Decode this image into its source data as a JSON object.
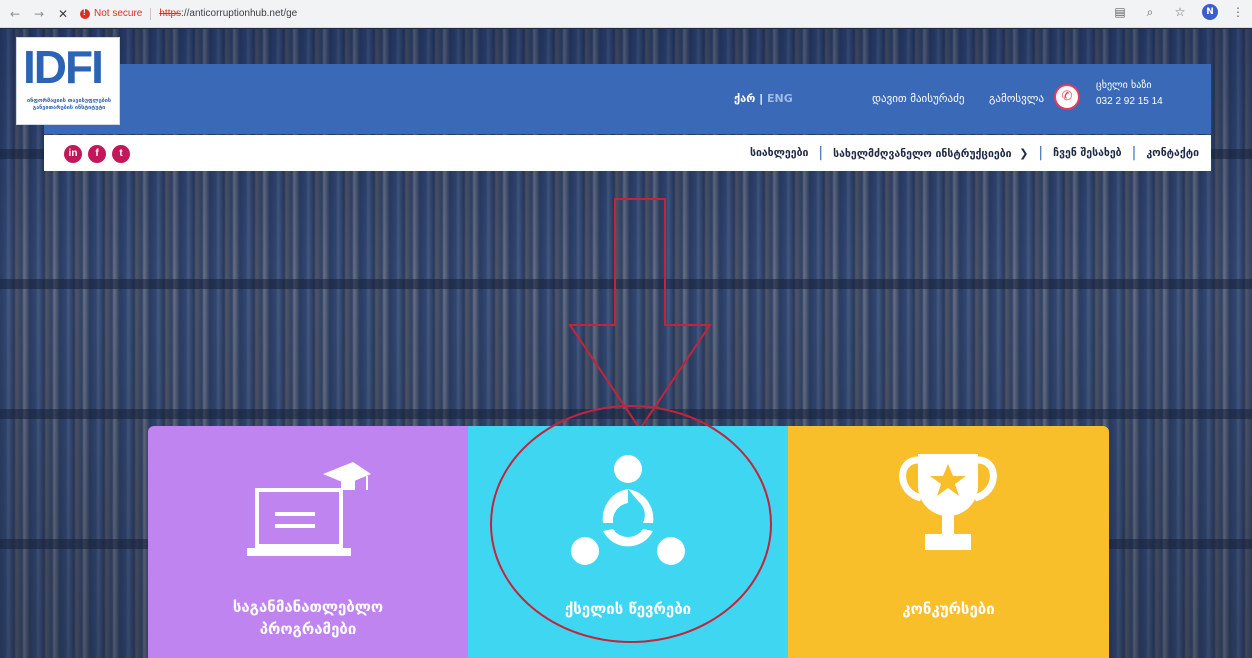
{
  "browser": {
    "nav": {
      "back": "←",
      "forward": "→",
      "stop": "✕"
    },
    "security_text": "Not secure",
    "url_scheme": "https",
    "url_rest": "://anticorruptionhub.net/ge",
    "profile_initial": "N"
  },
  "header": {
    "logo_text": "IDFI",
    "logo_subtitle": "ინფორმაციის თავისუფლების განვითარების ინსტიტუტი",
    "lang_ka": "ქარ",
    "lang_sep": "|",
    "lang_en": "ENG",
    "user_name": "დავით მაისურაძე",
    "logout": "გამოსვლა",
    "hotline_label": "ცხელი ხაზი",
    "hotline_number": "032 2 92 15 14"
  },
  "navbar": {
    "social": [
      "in",
      "f",
      "t"
    ],
    "items": [
      "სიახლეები",
      "სახელმძღვანელო ინსტრუქციები",
      "ჩვენ შესახებ",
      "კონტაქტი"
    ]
  },
  "cards": [
    {
      "label_line1": "საგანმანათლებლო",
      "label_line2": "პროგრამები",
      "color": "#c084f0"
    },
    {
      "label_line1": "ქსელის წევრები",
      "color": "#3fd6f2"
    },
    {
      "label_line1": "კონკურსები",
      "color": "#f8bf2b"
    }
  ],
  "colors": {
    "header_blue": "#3a69b8",
    "annotation_red": "#c3243b"
  }
}
